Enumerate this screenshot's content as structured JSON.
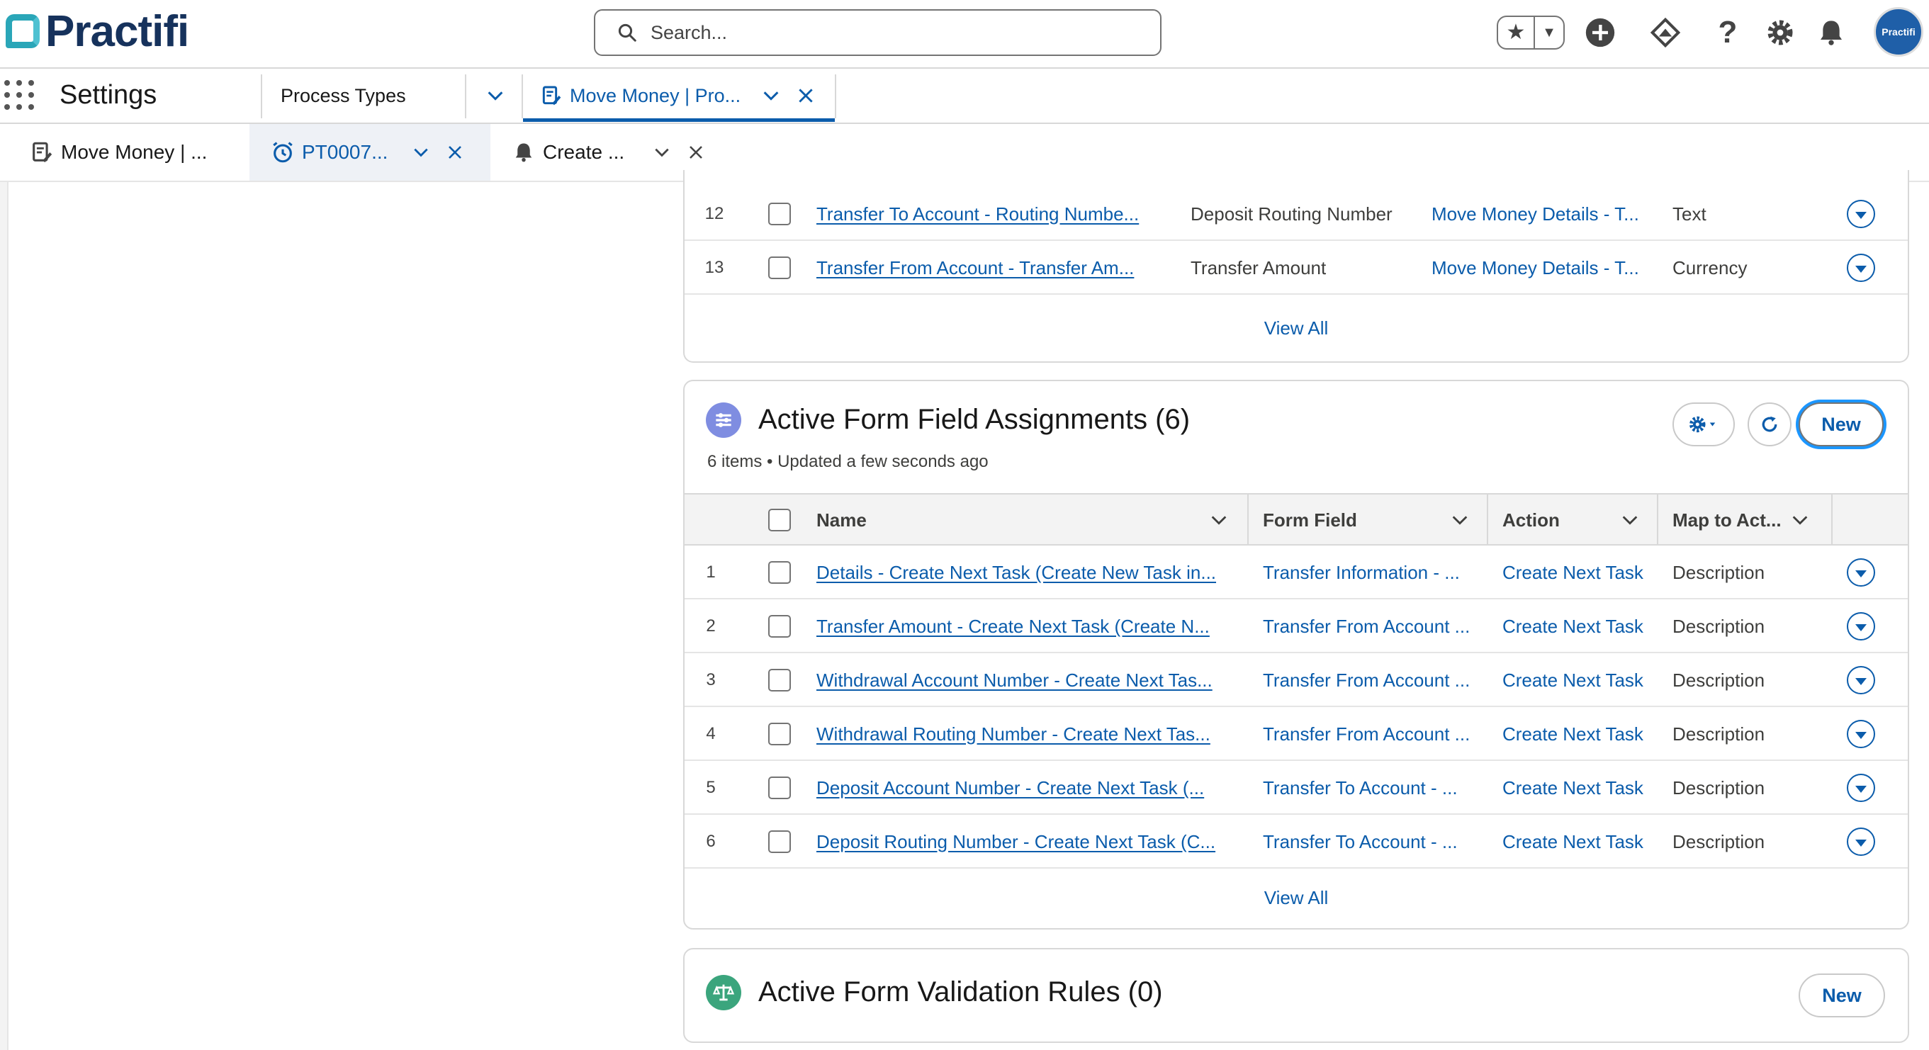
{
  "header": {
    "logo_text": "Practifi",
    "search_placeholder": "Search...",
    "avatar_text": "Practifi"
  },
  "nav": {
    "app_name": "Settings",
    "items": [
      {
        "label": "Process Types"
      },
      {
        "label": "Move Money | Pro..."
      }
    ]
  },
  "subtabs": [
    {
      "label": "Move Money | ..."
    },
    {
      "label": "PT0007..."
    },
    {
      "label": "Create ..."
    }
  ],
  "top_card": {
    "rows": [
      {
        "num": "12",
        "name": "Transfer To Account - Routing Numbe...",
        "field": "Deposit Routing Number",
        "section": "Move Money Details - T...",
        "type": "Text"
      },
      {
        "num": "13",
        "name": "Transfer From Account - Transfer Am...",
        "field": "Transfer Amount",
        "section": "Move Money Details - T...",
        "type": "Currency"
      }
    ],
    "view_all": "View All"
  },
  "assignments_card": {
    "title": "Active Form Field Assignments (6)",
    "subtitle": "6 items • Updated a few seconds ago",
    "new_label": "New",
    "columns": [
      "Name",
      "Form Field",
      "Action",
      "Map to Act..."
    ],
    "rows": [
      {
        "num": "1",
        "name": "Details - Create Next Task (Create New Task in...",
        "form_field": "Transfer Information - ...",
        "action": "Create Next Task",
        "map": "Description"
      },
      {
        "num": "2",
        "name": "Transfer Amount - Create Next Task (Create N...",
        "form_field": "Transfer From Account ...",
        "action": "Create Next Task",
        "map": "Description"
      },
      {
        "num": "3",
        "name": "Withdrawal Account Number - Create Next Tas...",
        "form_field": "Transfer From Account ...",
        "action": "Create Next Task",
        "map": "Description"
      },
      {
        "num": "4",
        "name": "Withdrawal Routing Number - Create Next Tas...",
        "form_field": "Transfer From Account ...",
        "action": "Create Next Task",
        "map": "Description"
      },
      {
        "num": "5",
        "name": "Deposit Account Number - Create Next Task (...",
        "form_field": "Transfer To Account - ...",
        "action": "Create Next Task",
        "map": "Description"
      },
      {
        "num": "6",
        "name": "Deposit Routing Number - Create Next Task (C...",
        "form_field": "Transfer To Account - ...",
        "action": "Create Next Task",
        "map": "Description"
      }
    ],
    "view_all": "View All"
  },
  "validation_card": {
    "title": "Active Form Validation Rules (0)",
    "new_label": "New"
  },
  "colors": {
    "link": "#0b5cab",
    "brand_navy": "#16325c",
    "brand_teal": "#2aa6b8",
    "assignments_icon": "#7f8de1",
    "validation_icon": "#3ba57d",
    "focus_ring": "#1b96ff"
  }
}
